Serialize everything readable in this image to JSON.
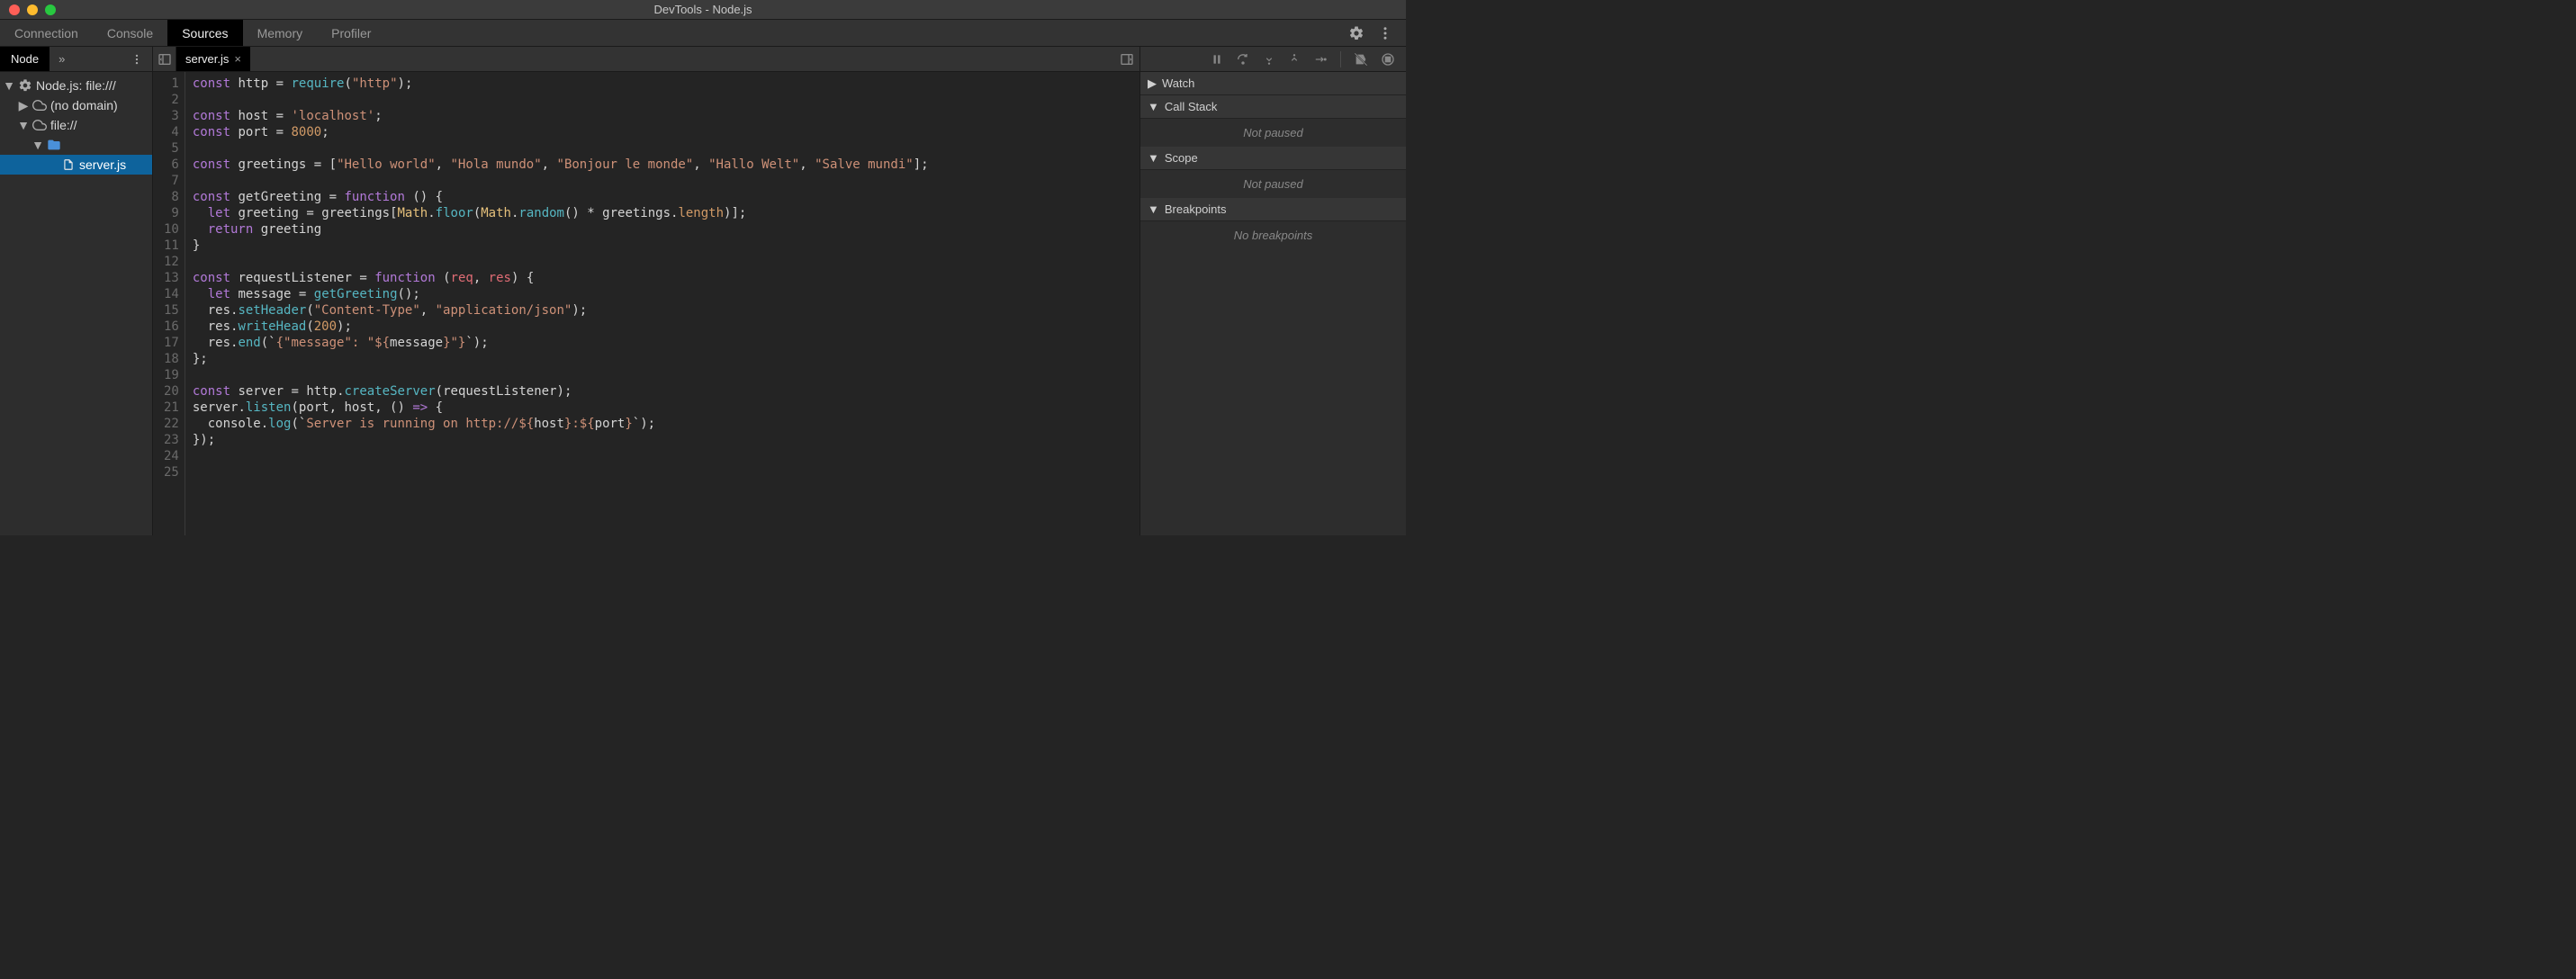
{
  "window": {
    "title": "DevTools - Node.js"
  },
  "main_tabs": {
    "items": [
      "Connection",
      "Console",
      "Sources",
      "Memory",
      "Profiler"
    ],
    "active": "Sources"
  },
  "sidebar": {
    "tab_label": "Node",
    "tree": {
      "root_label": "Node.js: file:///",
      "no_domain_label": "(no domain)",
      "file_scheme_label": "file://",
      "active_file": "server.js"
    }
  },
  "editor": {
    "open_file": "server.js",
    "code_lines": [
      [
        [
          "kw",
          "const"
        ],
        [
          "sp",
          " "
        ],
        [
          "ident",
          "http"
        ],
        [
          "sp",
          " "
        ],
        [
          "op",
          "="
        ],
        [
          "sp",
          " "
        ],
        [
          "fn",
          "require"
        ],
        [
          "op",
          "("
        ],
        [
          "str",
          "\"http\""
        ],
        [
          "op",
          ");"
        ]
      ],
      [],
      [
        [
          "kw",
          "const"
        ],
        [
          "sp",
          " "
        ],
        [
          "ident",
          "host"
        ],
        [
          "sp",
          " "
        ],
        [
          "op",
          "="
        ],
        [
          "sp",
          " "
        ],
        [
          "str",
          "'localhost'"
        ],
        [
          "op",
          ";"
        ]
      ],
      [
        [
          "kw",
          "const"
        ],
        [
          "sp",
          " "
        ],
        [
          "ident",
          "port"
        ],
        [
          "sp",
          " "
        ],
        [
          "op",
          "="
        ],
        [
          "sp",
          " "
        ],
        [
          "num",
          "8000"
        ],
        [
          "op",
          ";"
        ]
      ],
      [],
      [
        [
          "kw",
          "const"
        ],
        [
          "sp",
          " "
        ],
        [
          "ident",
          "greetings"
        ],
        [
          "sp",
          " "
        ],
        [
          "op",
          "="
        ],
        [
          "sp",
          " "
        ],
        [
          "op",
          "["
        ],
        [
          "str",
          "\"Hello world\""
        ],
        [
          "op",
          ", "
        ],
        [
          "str",
          "\"Hola mundo\""
        ],
        [
          "op",
          ", "
        ],
        [
          "str",
          "\"Bonjour le monde\""
        ],
        [
          "op",
          ", "
        ],
        [
          "str",
          "\"Hallo Welt\""
        ],
        [
          "op",
          ", "
        ],
        [
          "str",
          "\"Salve mundi\""
        ],
        [
          "op",
          "];"
        ]
      ],
      [],
      [
        [
          "kw",
          "const"
        ],
        [
          "sp",
          " "
        ],
        [
          "ident",
          "getGreeting"
        ],
        [
          "sp",
          " "
        ],
        [
          "op",
          "="
        ],
        [
          "sp",
          " "
        ],
        [
          "kw",
          "function"
        ],
        [
          "sp",
          " "
        ],
        [
          "op",
          "() {"
        ]
      ],
      [
        [
          "sp",
          "  "
        ],
        [
          "kw",
          "let"
        ],
        [
          "sp",
          " "
        ],
        [
          "ident",
          "greeting"
        ],
        [
          "sp",
          " "
        ],
        [
          "op",
          "="
        ],
        [
          "sp",
          " "
        ],
        [
          "ident",
          "greetings"
        ],
        [
          "op",
          "["
        ],
        [
          "obj",
          "Math"
        ],
        [
          "op",
          "."
        ],
        [
          "fn",
          "floor"
        ],
        [
          "op",
          "("
        ],
        [
          "obj",
          "Math"
        ],
        [
          "op",
          "."
        ],
        [
          "fn",
          "random"
        ],
        [
          "op",
          "()"
        ],
        [
          "sp",
          " "
        ],
        [
          "op",
          "*"
        ],
        [
          "sp",
          " "
        ],
        [
          "ident",
          "greetings"
        ],
        [
          "op",
          "."
        ],
        [
          "prop",
          "length"
        ],
        [
          "op",
          ")];"
        ]
      ],
      [
        [
          "sp",
          "  "
        ],
        [
          "kw",
          "return"
        ],
        [
          "sp",
          " "
        ],
        [
          "ident",
          "greeting"
        ]
      ],
      [
        [
          "op",
          "}"
        ]
      ],
      [],
      [
        [
          "kw",
          "const"
        ],
        [
          "sp",
          " "
        ],
        [
          "ident",
          "requestListener"
        ],
        [
          "sp",
          " "
        ],
        [
          "op",
          "="
        ],
        [
          "sp",
          " "
        ],
        [
          "kw",
          "function"
        ],
        [
          "sp",
          " "
        ],
        [
          "op",
          "("
        ],
        [
          "param",
          "req"
        ],
        [
          "op",
          ", "
        ],
        [
          "param",
          "res"
        ],
        [
          "op",
          ") {"
        ]
      ],
      [
        [
          "sp",
          "  "
        ],
        [
          "kw",
          "let"
        ],
        [
          "sp",
          " "
        ],
        [
          "ident",
          "message"
        ],
        [
          "sp",
          " "
        ],
        [
          "op",
          "="
        ],
        [
          "sp",
          " "
        ],
        [
          "fn",
          "getGreeting"
        ],
        [
          "op",
          "();"
        ]
      ],
      [
        [
          "sp",
          "  "
        ],
        [
          "ident",
          "res"
        ],
        [
          "op",
          "."
        ],
        [
          "fn",
          "setHeader"
        ],
        [
          "op",
          "("
        ],
        [
          "str",
          "\"Content-Type\""
        ],
        [
          "op",
          ", "
        ],
        [
          "str",
          "\"application/json\""
        ],
        [
          "op",
          ");"
        ]
      ],
      [
        [
          "sp",
          "  "
        ],
        [
          "ident",
          "res"
        ],
        [
          "op",
          "."
        ],
        [
          "fn",
          "writeHead"
        ],
        [
          "op",
          "("
        ],
        [
          "num",
          "200"
        ],
        [
          "op",
          ");"
        ]
      ],
      [
        [
          "sp",
          "  "
        ],
        [
          "ident",
          "res"
        ],
        [
          "op",
          "."
        ],
        [
          "fn",
          "end"
        ],
        [
          "op",
          "(`"
        ],
        [
          "str",
          "{\"message\": \"${"
        ],
        [
          "ident",
          "message"
        ],
        [
          "str",
          "}\"}"
        ],
        [
          "op",
          "`);"
        ]
      ],
      [
        [
          "op",
          "};"
        ]
      ],
      [],
      [
        [
          "kw",
          "const"
        ],
        [
          "sp",
          " "
        ],
        [
          "ident",
          "server"
        ],
        [
          "sp",
          " "
        ],
        [
          "op",
          "="
        ],
        [
          "sp",
          " "
        ],
        [
          "ident",
          "http"
        ],
        [
          "op",
          "."
        ],
        [
          "fn",
          "createServer"
        ],
        [
          "op",
          "("
        ],
        [
          "ident",
          "requestListener"
        ],
        [
          "op",
          ");"
        ]
      ],
      [
        [
          "ident",
          "server"
        ],
        [
          "op",
          "."
        ],
        [
          "fn",
          "listen"
        ],
        [
          "op",
          "("
        ],
        [
          "ident",
          "port"
        ],
        [
          "op",
          ", "
        ],
        [
          "ident",
          "host"
        ],
        [
          "op",
          ", () "
        ],
        [
          "kw",
          "=>"
        ],
        [
          "op",
          " {"
        ]
      ],
      [
        [
          "sp",
          "  "
        ],
        [
          "ident",
          "console"
        ],
        [
          "op",
          "."
        ],
        [
          "fn",
          "log"
        ],
        [
          "op",
          "(`"
        ],
        [
          "str",
          "Server is running on http://${"
        ],
        [
          "ident",
          "host"
        ],
        [
          "str",
          "}:${"
        ],
        [
          "ident",
          "port"
        ],
        [
          "str",
          "}"
        ],
        [
          "op",
          "`);"
        ]
      ],
      [
        [
          "op",
          "});"
        ]
      ],
      [],
      []
    ]
  },
  "debugger": {
    "sections": {
      "watch": {
        "label": "Watch"
      },
      "call_stack": {
        "label": "Call Stack",
        "body": "Not paused"
      },
      "scope": {
        "label": "Scope",
        "body": "Not paused"
      },
      "breakpoints": {
        "label": "Breakpoints",
        "body": "No breakpoints"
      }
    }
  }
}
